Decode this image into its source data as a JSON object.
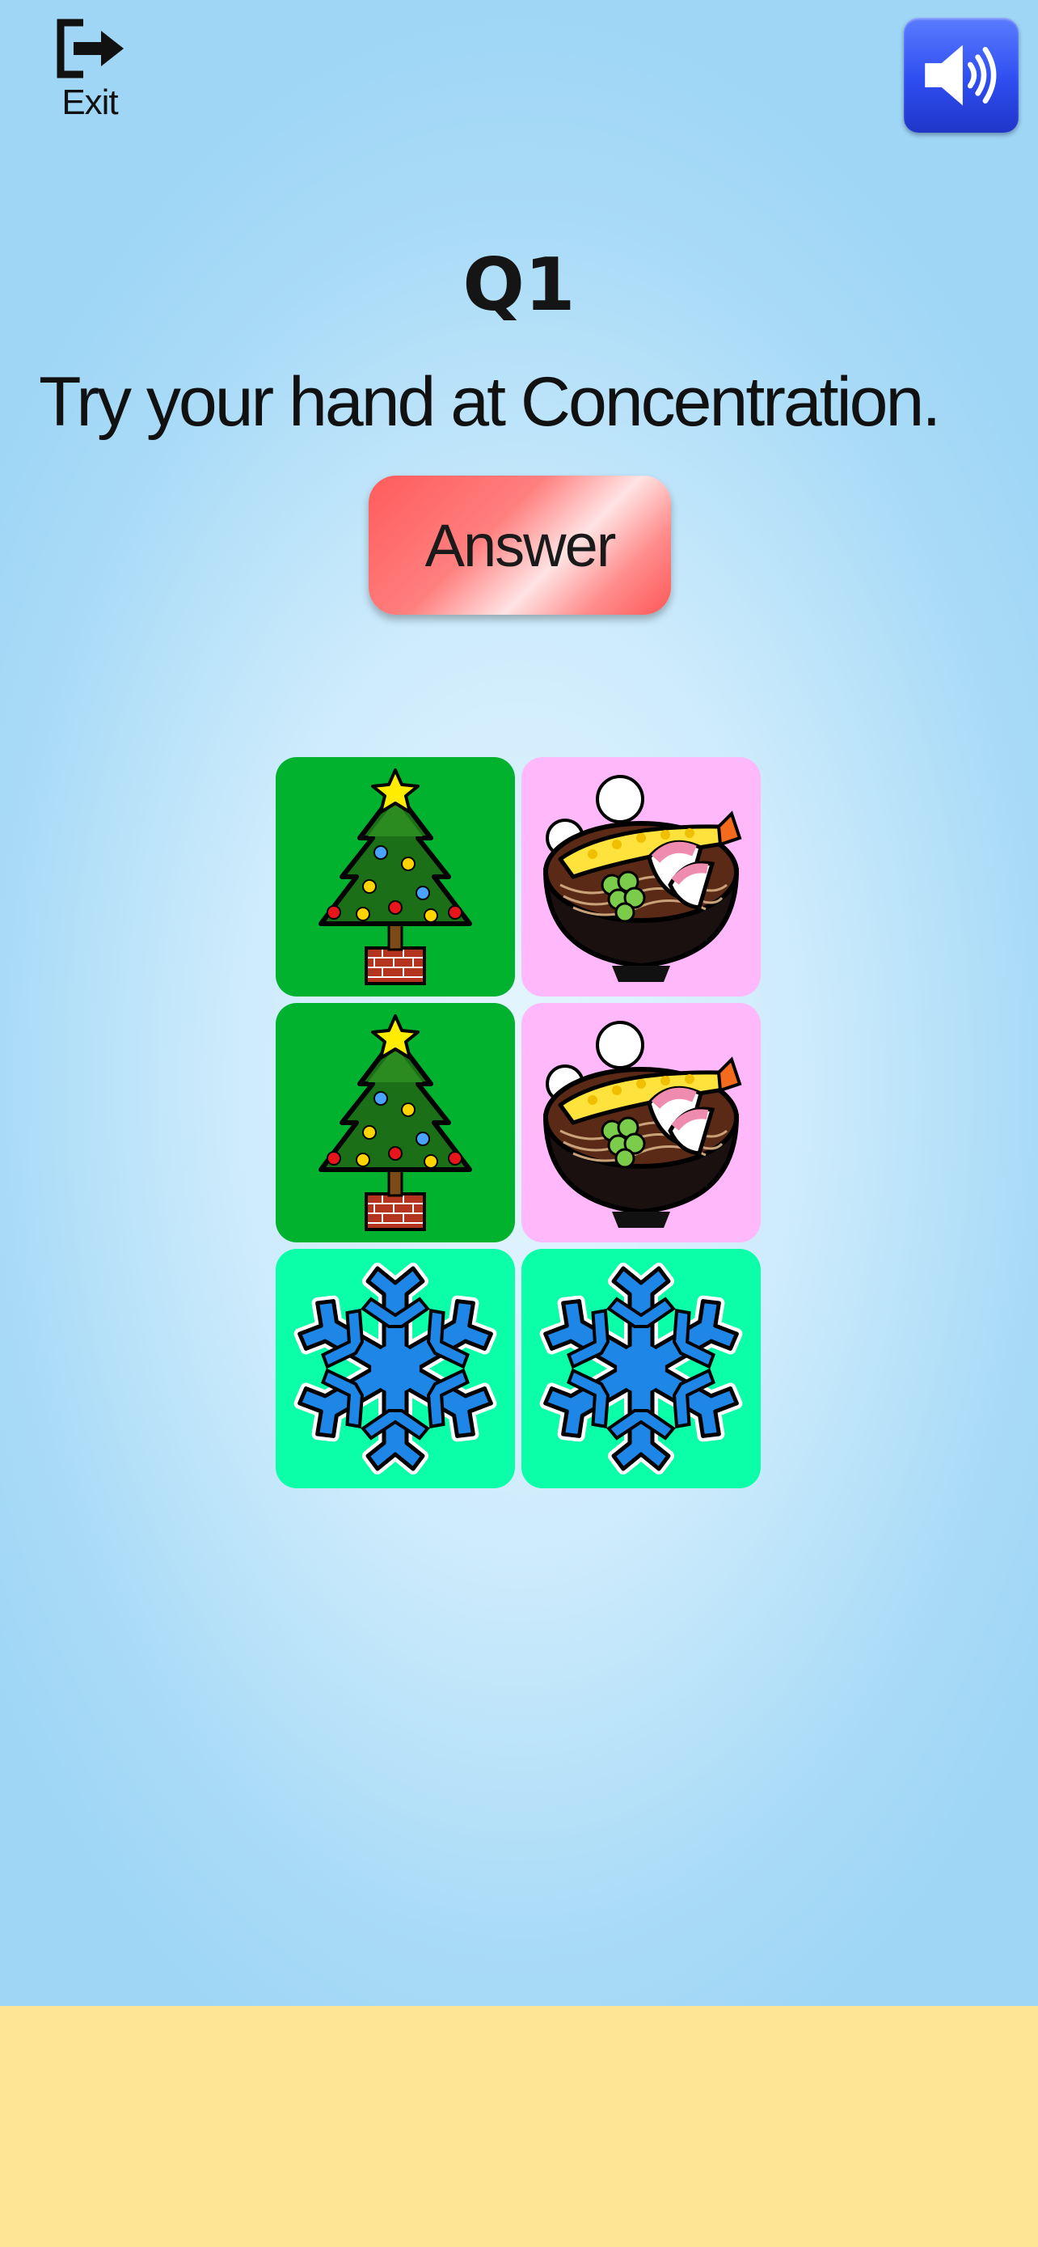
{
  "header": {
    "exit_label": "Exit",
    "exit_icon": "exit-icon",
    "sound_icon": "speaker-volume-icon"
  },
  "question": {
    "number": "Q1",
    "text": "Try your hand at Concentration.",
    "answer_label": "Answer"
  },
  "cards": [
    {
      "symbol": "christmas-tree",
      "background": "#00b22d"
    },
    {
      "symbol": "soba-bowl",
      "background": "#ffb8fa"
    },
    {
      "symbol": "christmas-tree",
      "background": "#00b22d"
    },
    {
      "symbol": "soba-bowl",
      "background": "#ffb8fa"
    },
    {
      "symbol": "snowflake",
      "background": "#0affa8"
    },
    {
      "symbol": "snowflake",
      "background": "#0affa8"
    }
  ],
  "colors": {
    "bottom_band": "#fee495",
    "answer_button": "#ff6b6b",
    "sound_button": "#2e4df0"
  }
}
